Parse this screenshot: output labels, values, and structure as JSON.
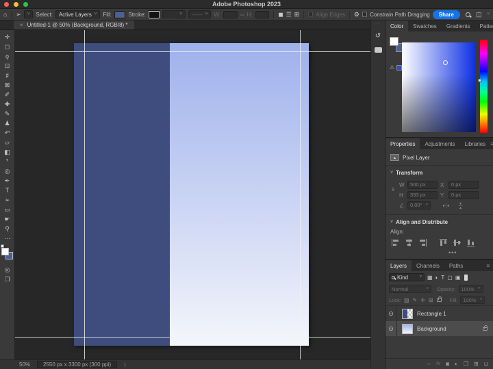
{
  "titlebar": {
    "title": "Adobe Photoshop 2023"
  },
  "options_bar": {
    "select_label": "Select:",
    "select_value": "Active Layers",
    "fill_label": "Fill:",
    "stroke_label": "Stroke:",
    "w_label": "W:",
    "h_label": "H:",
    "align_edges_label": "Align Edges",
    "constrain_label": "Constrain Path Dragging",
    "share_label": "Share",
    "fill_swatch_color": "#4a5f9f"
  },
  "document_tab": {
    "close": "×",
    "title": "Untitled-1 @ 50% (Background, RGB/8) *"
  },
  "toolbar": {
    "tools": [
      {
        "name": "move-tool",
        "glyph": "✛"
      },
      {
        "name": "marquee-tool",
        "glyph": "◻"
      },
      {
        "name": "lasso-tool",
        "glyph": "ϙ"
      },
      {
        "name": "object-selection-tool",
        "glyph": "⊡"
      },
      {
        "name": "crop-tool",
        "glyph": "♯"
      },
      {
        "name": "frame-tool",
        "glyph": "⊠"
      },
      {
        "name": "eyedropper-tool",
        "glyph": "✐"
      },
      {
        "name": "healing-brush-tool",
        "glyph": "✚"
      },
      {
        "name": "brush-tool",
        "glyph": "✎"
      },
      {
        "name": "clone-stamp-tool",
        "glyph": "♟"
      },
      {
        "name": "history-brush-tool",
        "glyph": "↶"
      },
      {
        "name": "eraser-tool",
        "glyph": "▱"
      },
      {
        "name": "gradient-tool",
        "glyph": "◧"
      },
      {
        "name": "blur-tool",
        "glyph": "❜"
      },
      {
        "name": "dodge-tool",
        "glyph": "◎"
      },
      {
        "name": "pen-tool",
        "glyph": "✒"
      },
      {
        "name": "type-tool",
        "glyph": "T"
      },
      {
        "name": "path-selection-tool",
        "glyph": "➢"
      },
      {
        "name": "rectangle-tool",
        "glyph": "▭"
      },
      {
        "name": "hand-tool",
        "glyph": "☛"
      },
      {
        "name": "zoom-tool",
        "glyph": "⚲"
      },
      {
        "name": "edit-toolbar",
        "glyph": "⋯"
      }
    ],
    "foreground_color": "#ffffff",
    "background_color": "#4a5f9f"
  },
  "canvas": {
    "rectangle_color": "#3e4d7e",
    "gradient_top": "#9fb1ec",
    "gradient_bottom": "#f4f6fb"
  },
  "icons": {
    "home": "⌂",
    "tool_arrow": "➢",
    "chevron": "˅",
    "gear": "⚙",
    "workspace": "◫",
    "panel_menu": "≡",
    "link": "∞",
    "bool_ops": "◼",
    "align_ops": "☰",
    "arrange_ops": "⊞",
    "history": "↺",
    "grip": "∙∙",
    "warning": "⚠",
    "angle": "∠",
    "flip_h": "▸∣◂",
    "eye": "⊙",
    "filter_pixel": "▦",
    "filter_adjust": "◐",
    "filter_type": "T",
    "filter_shape": "▢",
    "filter_smart": "▣",
    "lock_transparent": "▨",
    "lock_paint": "✎",
    "lock_move": "✛",
    "lock_artboard": "⊞",
    "mask": "◙",
    "adjustment": "◐",
    "group": "❒",
    "new_layer": "⊞",
    "trash": "⊔",
    "fx": "fx",
    "stroke_line": "——",
    "status_chevron": "⟩",
    "more": "•••"
  },
  "panels": {
    "color": {
      "tabs": [
        "Color",
        "Swatches",
        "Gradients",
        "Patterns"
      ]
    },
    "properties": {
      "tabs": [
        "Properties",
        "Adjustments",
        "Libraries"
      ],
      "layer_type": "Pixel Layer",
      "transform": {
        "title": "Transform",
        "w_label": "W",
        "w_value": "500 px",
        "x_label": "X",
        "x_value": "0 px",
        "h_label": "H",
        "h_value": "333 px",
        "y_label": "Y",
        "y_value": "0 px",
        "angle_value": "0.00°"
      },
      "align": {
        "title": "Align and Distribute",
        "label": "Align:"
      }
    },
    "layers": {
      "tabs": [
        "Layers",
        "Channels",
        "Paths"
      ],
      "kind": "Kind",
      "blend_mode": "Normal",
      "opacity_label": "Opacity:",
      "opacity_value": "100%",
      "lock_label": "Lock:",
      "fill_label": "Fill:",
      "fill_value": "100%",
      "rows": [
        {
          "name": "Rectangle 1"
        },
        {
          "name": "Background"
        }
      ]
    }
  },
  "status_bar": {
    "zoom": "50%",
    "doc_info": "2550 px x 3300 px (300 ppi)"
  }
}
